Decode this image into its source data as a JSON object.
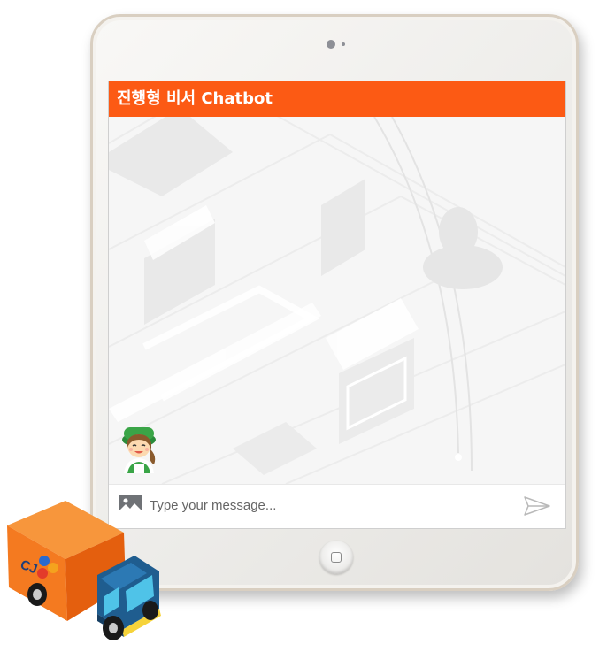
{
  "chatbot": {
    "title": "진행형 비서 Chatbot",
    "input_placeholder": "Type your message..."
  },
  "truck": {
    "logo_text": "CJ"
  },
  "colors": {
    "header": "#fc5a14",
    "truck_cargo": "#f47a20",
    "truck_cab": "#1f5d8f"
  },
  "icons": {
    "attach": "image-icon",
    "send": "paper-plane-icon",
    "home": "home-button-icon",
    "camera": "camera-icon"
  }
}
